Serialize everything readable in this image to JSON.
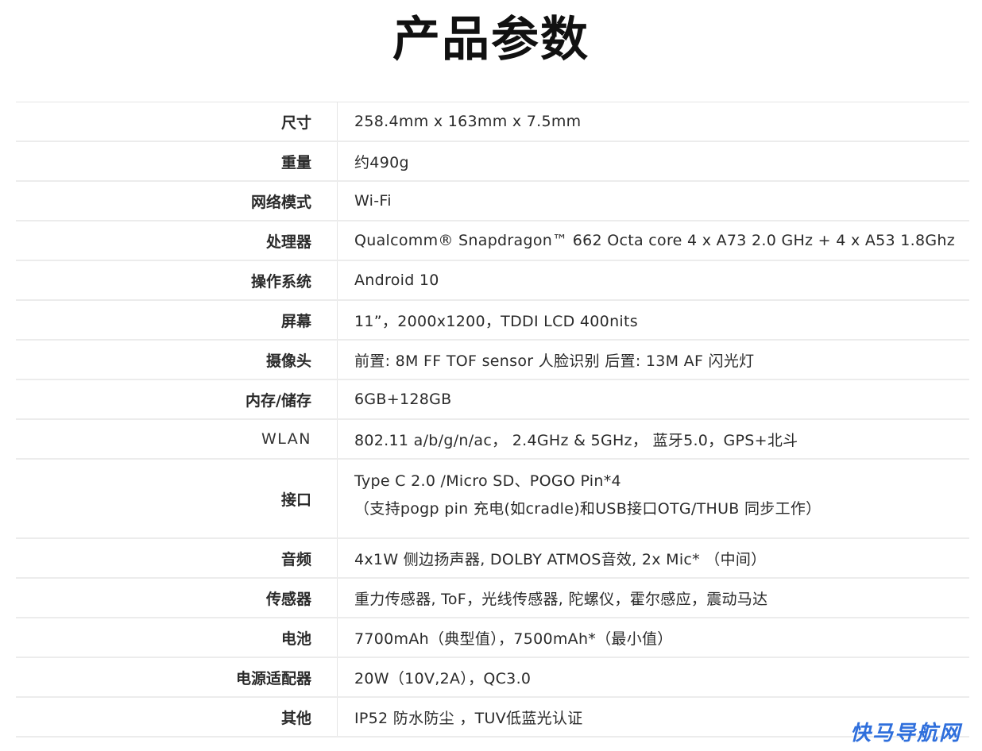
{
  "title": "产品参数",
  "specs": [
    {
      "label": "尺寸",
      "value": "258.4mm x 163mm x 7.5mm"
    },
    {
      "label": "重量",
      "value": "约490g"
    },
    {
      "label": "网络模式",
      "value": "Wi-Fi"
    },
    {
      "label": "处理器",
      "value": "Qualcomm® Snapdragon™ 662 Octa core 4 x A73 2.0 GHz + 4 x A53 1.8Ghz"
    },
    {
      "label": "操作系统",
      "value": "Android 10"
    },
    {
      "label": "屏幕",
      "value": "11”，2000x1200，TDDI LCD 400nits"
    },
    {
      "label": "摄像头",
      "value": "前置: 8M FF TOF sensor  人脸识别  后置: 13M AF 闪光灯"
    },
    {
      "label": "内存/储存",
      "value": "6GB+128GB"
    },
    {
      "label": "WLAN",
      "value": "802.11 a/b/g/n/ac， 2.4GHz & 5GHz，  蓝牙5.0，GPS+北斗"
    },
    {
      "label": "接口",
      "value": "Type C 2.0 /Micro SD、POGO Pin*4",
      "value2": "（支持pogp pin 充电(如cradle)和USB接口OTG/THUB 同步工作）"
    },
    {
      "label": "音频",
      "value": "4x1W 侧边扬声器, DOLBY ATMOS音效, 2x Mic* （中间）"
    },
    {
      "label": "传感器",
      "value": "重力传感器, ToF，光线传感器, 陀螺仪，霍尔感应，震动马达"
    },
    {
      "label": "电池",
      "value": "7700mAh（典型值），7500mAh*（最小值）"
    },
    {
      "label": "电源适配器",
      "value": "20W（10V,2A），QC3.0"
    },
    {
      "label": "其他",
      "value": "IP52 防水防尘 ，TUV低蓝光认证"
    }
  ],
  "watermark": "快马导航网"
}
